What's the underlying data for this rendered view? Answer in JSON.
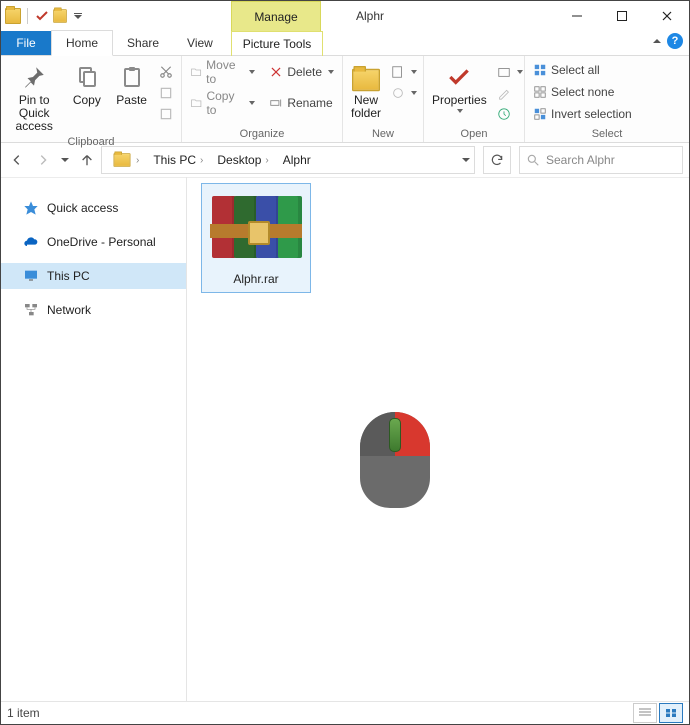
{
  "window": {
    "title": "Alphr"
  },
  "tabs": {
    "contextual_group": "Manage",
    "contextual_tab": "Picture Tools",
    "file": "File",
    "home": "Home",
    "share": "Share",
    "view": "View"
  },
  "ribbon": {
    "clipboard": {
      "label": "Clipboard",
      "pin": "Pin to Quick\naccess",
      "copy": "Copy",
      "paste": "Paste"
    },
    "organize": {
      "label": "Organize",
      "moveto": "Move to",
      "copyto": "Copy to",
      "delete": "Delete",
      "rename": "Rename"
    },
    "new": {
      "label": "New",
      "newfolder": "New\nfolder"
    },
    "open": {
      "label": "Open",
      "properties": "Properties"
    },
    "select": {
      "label": "Select",
      "selectall": "Select all",
      "selectnone": "Select none",
      "invert": "Invert selection"
    }
  },
  "address": {
    "crumbs": [
      "This PC",
      "Desktop",
      "Alphr"
    ]
  },
  "search": {
    "placeholder": "Search Alphr"
  },
  "nav": {
    "quick": "Quick access",
    "onedrive": "OneDrive - Personal",
    "thispc": "This PC",
    "network": "Network"
  },
  "file": {
    "name": "Alphr.rar"
  },
  "status": {
    "count": "1 item"
  }
}
